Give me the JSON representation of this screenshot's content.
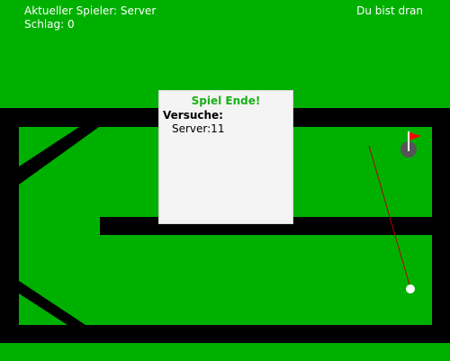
{
  "hud": {
    "player_text": "Aktueller Spieler: Server",
    "stroke_text": "Schlag: 0",
    "turn_text": "Du bist dran"
  },
  "dialog": {
    "title": "Spiel Ende!",
    "heading": "Versuche:",
    "result_text": "Server:11"
  },
  "colors": {
    "grass": "#00b000",
    "wall": "#000000",
    "flag": "#ff0000",
    "aim_line": "#b00000",
    "ball": "#ffffff",
    "title": "#18b018"
  }
}
